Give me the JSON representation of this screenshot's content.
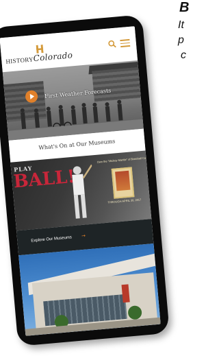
{
  "side_text": {
    "title": "B",
    "lines": [
      "It",
      "p",
      "c"
    ]
  },
  "header": {
    "logo_word": "HISTORY",
    "logo_script": "Colorado",
    "brand_color": "#d49a3a",
    "search_icon": "search-icon",
    "menu_icon": "hamburger-icon"
  },
  "hero": {
    "caption": "First Weather Forecasts",
    "play_color": "#e0802a"
  },
  "whats_on": {
    "title": "What's On at Our Museums"
  },
  "play_ball": {
    "small_title": "PLAY",
    "big_title": "BALL!",
    "card_label": "Own the \"Mickey Mantle\" of Baseball Cards",
    "dates": "THROUGH APRIL 30, 2017"
  },
  "explore": {
    "label": "Explore Our Museums",
    "arrow": "→"
  }
}
